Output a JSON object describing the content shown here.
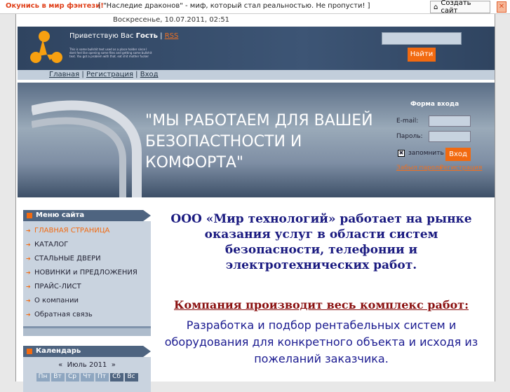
{
  "topbar": {
    "promo": "Окунись в мир фэнтези!",
    "promo_text": "[ \"Наследие драконов\" - миф, который стал реальностью. Не пропусти! ]",
    "create_site": "Создать сайт",
    "close": "✕"
  },
  "header": {
    "date": "Воскресенье, 10.07.2011, 02:51",
    "greeting": "Приветствую Вас",
    "user": "Гость",
    "rss": "RSS",
    "placeholder_text": "This is some bullshit text used as a place holder since I dont feel like opening some files and getting some bullshit text. You got a problem with that. eat shit mother fucker",
    "search_button": "Найти"
  },
  "nav": {
    "items": [
      "Главная",
      "Регистрация",
      "Вход"
    ]
  },
  "banner": {
    "slogan": "\"МЫ РАБОТАЕМ ДЛЯ ВАШЕЙ БЕЗОПАСТНОСТИ И КОМФОРТА\""
  },
  "login": {
    "title": "Форма входа",
    "email_label": "E-mail:",
    "password_label": "Пароль:",
    "remember": "запомнить",
    "submit": "Вход",
    "forgot": "Забыл пароль",
    "register": "Регистрация"
  },
  "menu": {
    "title": "Меню сайта",
    "items": [
      "ГЛАВНАЯ СТРАНИЦА",
      "КАТАЛОГ",
      "СТАЛЬНЫЕ ДВЕРИ",
      "НОВИНКИ и ПРЕДЛОЖЕНИЯ",
      "ПРАЙС-ЛИСТ",
      "О компании",
      "Обратная связь"
    ]
  },
  "calendar": {
    "title": "Календарь",
    "prev": "«",
    "month": "Июль 2011",
    "next": "»",
    "days": [
      "Пн",
      "Вт",
      "Ср",
      "Чт",
      "Пт",
      "Сб",
      "Вс"
    ]
  },
  "content": {
    "intro": "ООО «Мир технологий» работает на рынке оказания услуг в области систем безопасности, телефонии и электротехнических работ.",
    "heading": "Компания производит весь комплекс работ:",
    "text": "Разработка и подбор рентабельных систем и оборудования для конкретного объекта и исходя из пожеланий заказчика."
  }
}
